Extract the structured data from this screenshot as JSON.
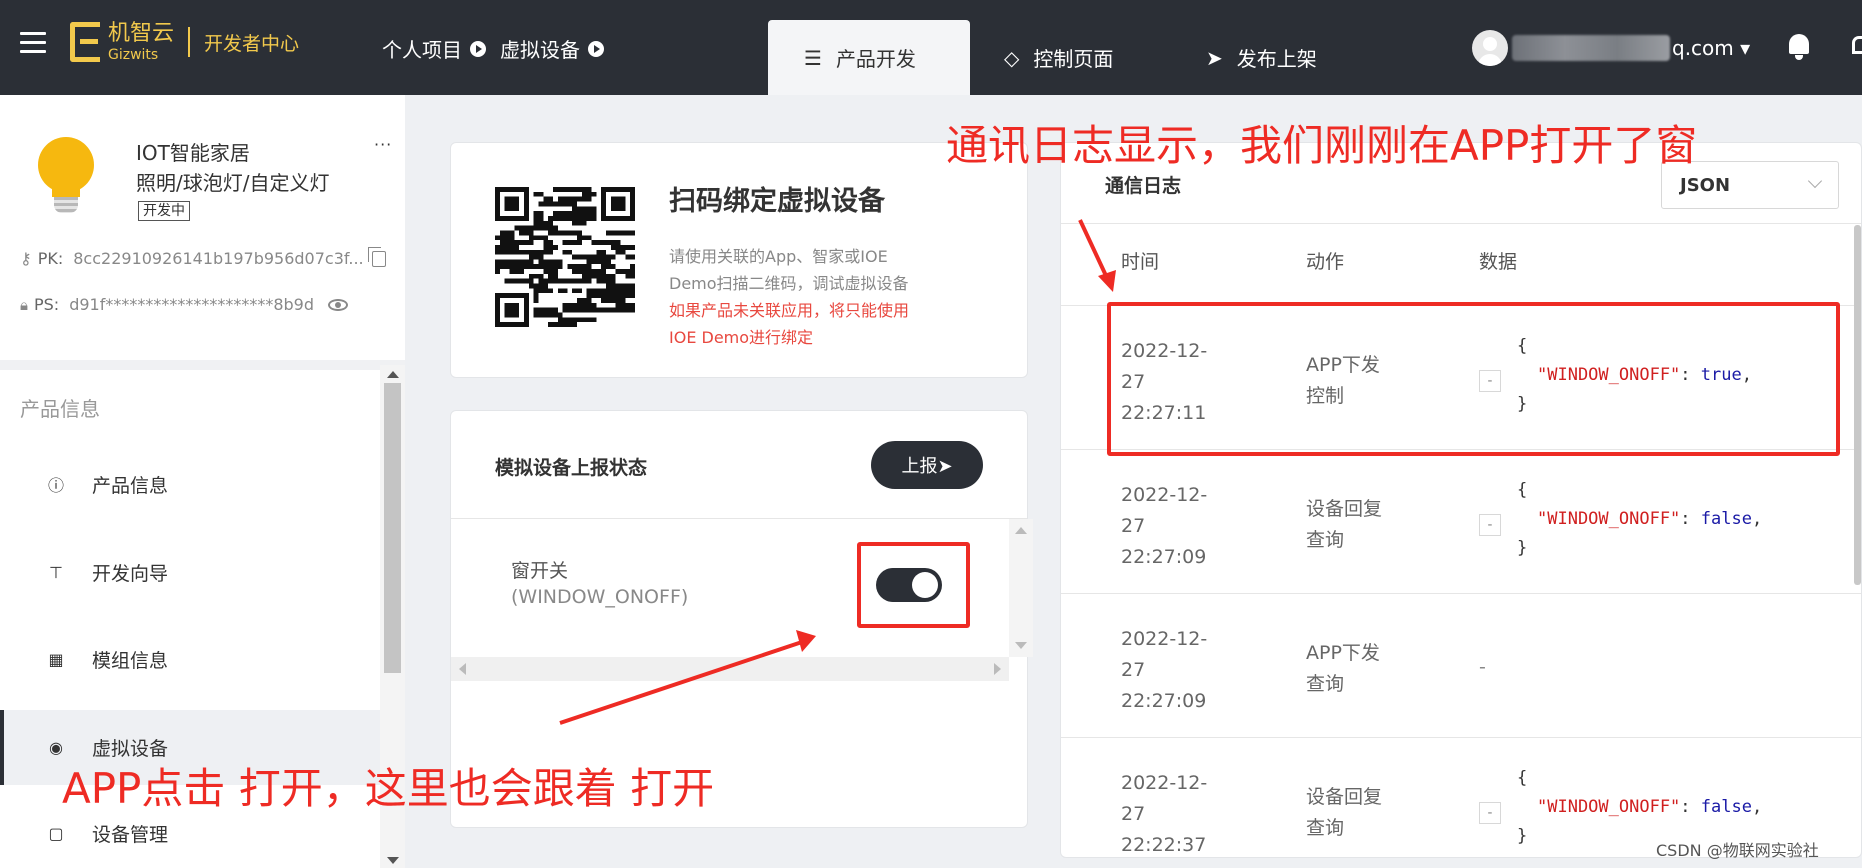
{
  "topbar": {
    "logo_cn": "机智云",
    "logo_en": "Gizwits",
    "dev_center": "开发者中心",
    "breadcrumb": [
      "个人项目",
      "虚拟设备"
    ],
    "tabs": [
      {
        "label": "产品开发",
        "icon": "sliders-icon",
        "active": true
      },
      {
        "label": "控制页面",
        "icon": "diamond-icon",
        "active": false
      },
      {
        "label": "发布上架",
        "icon": "send-icon",
        "active": false
      }
    ],
    "user_email_suffix": "q.com ▾"
  },
  "product": {
    "name": "IOT智能家居",
    "type": "照明/球泡灯/自定义灯",
    "status": "开发中",
    "more": "···",
    "pk_label": "PK:",
    "pk_value": "8cc22910926141b197b956d07c3f...",
    "ps_label": "PS:",
    "ps_value": "d91f*********************8b9d"
  },
  "sidebar": {
    "section_title": "产品信息",
    "items": [
      {
        "label": "产品信息",
        "icon": "info-icon"
      },
      {
        "label": "开发向导",
        "icon": "signpost-icon"
      },
      {
        "label": "模组信息",
        "icon": "grid-icon"
      },
      {
        "label": "虚拟设备",
        "icon": "globe-icon",
        "active": true
      },
      {
        "label": "设备管理",
        "icon": "clipboard-icon"
      }
    ]
  },
  "qr_card": {
    "title": "扫码绑定虚拟设备",
    "desc_line1": "请使用关联的App、智家或IOE",
    "desc_line2": "Demo扫描二维码，调试虚拟设备",
    "warn_line1": "如果产品未关联应用，将只能使用",
    "warn_line2": "IOE Demo进行绑定"
  },
  "state_card": {
    "title": "模拟设备上报状态",
    "report_button": "上报➤",
    "field_name": "窗开关",
    "field_key": "(WINDOW_ONOFF)",
    "toggle_on": true
  },
  "log_panel": {
    "title": "通信日志",
    "format": "JSON",
    "headers": [
      "时间",
      "动作",
      "数据"
    ],
    "rows": [
      {
        "date": "2022-12-",
        "day": "27",
        "time": "22:27:11",
        "action1": "APP下发",
        "action2": "控制",
        "key": "\"WINDOW_ONOFF\"",
        "value": "true"
      },
      {
        "date": "2022-12-",
        "day": "27",
        "time": "22:27:09",
        "action1": "设备回复",
        "action2": "查询",
        "key": "\"WINDOW_ONOFF\"",
        "value": "false"
      },
      {
        "date": "2022-12-",
        "day": "27",
        "time": "22:27:09",
        "action1": "APP下发",
        "action2": "查询",
        "empty": "-"
      },
      {
        "date": "2022-12-",
        "day": "27",
        "time": "22:22:37",
        "action1": "设备回复",
        "action2": "查询",
        "key": "\"WINDOW_ONOFF\"",
        "value": "false"
      }
    ],
    "json_open": "{",
    "json_close": "}",
    "json_colon": ": ",
    "json_comma": ",",
    "collapse_symbol": "-"
  },
  "annotations": {
    "top": "通讯日志显示，我们刚刚在APP打开了窗",
    "bottom": "APP点击 打开，这里也会跟着 打开"
  },
  "watermark": "CSDN @物联网实验社",
  "colors": {
    "topbar": "#2b2f36",
    "brand": "#f2c94c",
    "annotation": "#ee2b24",
    "json_key": "#d02020",
    "json_value": "#1a1aa6"
  }
}
